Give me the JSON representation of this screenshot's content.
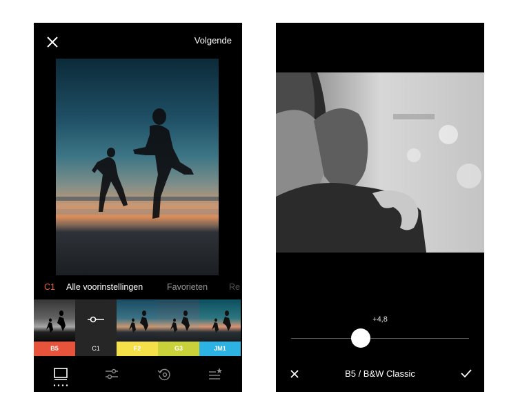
{
  "left_screen": {
    "header": {
      "next_label": "Volgende",
      "close_icon": "close-icon"
    },
    "preset_tabs": [
      {
        "label": "C1",
        "color": "#e8633d"
      },
      {
        "label": "Alle voorinstellingen",
        "color": "#ffffff"
      },
      {
        "label": "Favorieten",
        "color": "#9a9a9a"
      },
      {
        "label": "Re",
        "color": "#555555"
      }
    ],
    "presets": [
      {
        "label": "B5",
        "color": "#e8533b"
      },
      {
        "label": "C1",
        "color": "#262626",
        "selected": true
      },
      {
        "label": "F2",
        "color": "#f6e04a"
      },
      {
        "label": "G3",
        "color": "#c9d13b"
      },
      {
        "label": "JM1",
        "color": "#2cb3e3"
      }
    ],
    "nav_icons": [
      "grid-presets-icon",
      "adjust-sliders-icon",
      "history-icon",
      "recipes-icon"
    ]
  },
  "right_screen": {
    "slider_value": "+4,8",
    "slider_level": 0.39,
    "filter_name": "B5 / B&W Classic",
    "cancel_icon": "close-icon",
    "confirm_icon": "check-icon"
  }
}
